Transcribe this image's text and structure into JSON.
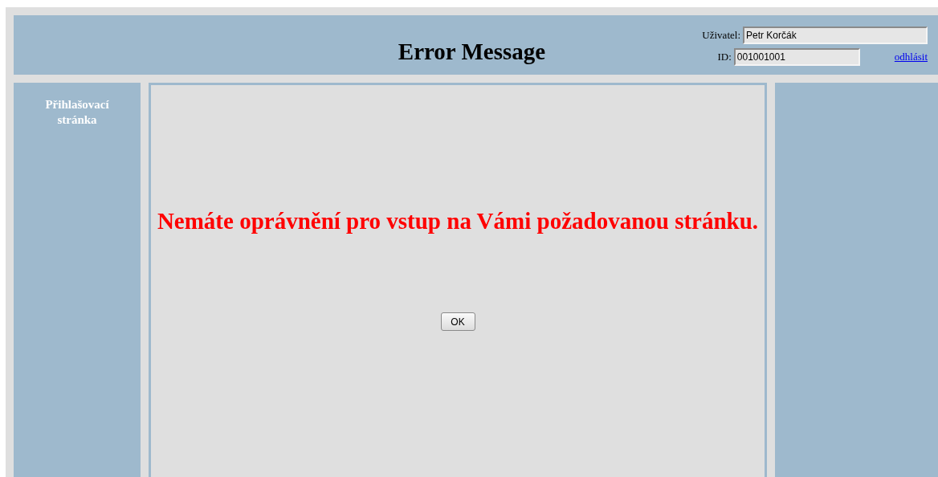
{
  "header": {
    "title": "Error Message",
    "user_label": "Uživatel:",
    "user_value": "Petr Korčák",
    "id_label": "ID:",
    "id_value": "001001001",
    "logout_link": "odhlásit"
  },
  "sidebar": {
    "items": [
      {
        "label": "Přihlašovací stránka"
      }
    ]
  },
  "main": {
    "message": "Nemáte oprávnění pro vstup na Vámi požadovanou stránku.",
    "button": "OK"
  }
}
